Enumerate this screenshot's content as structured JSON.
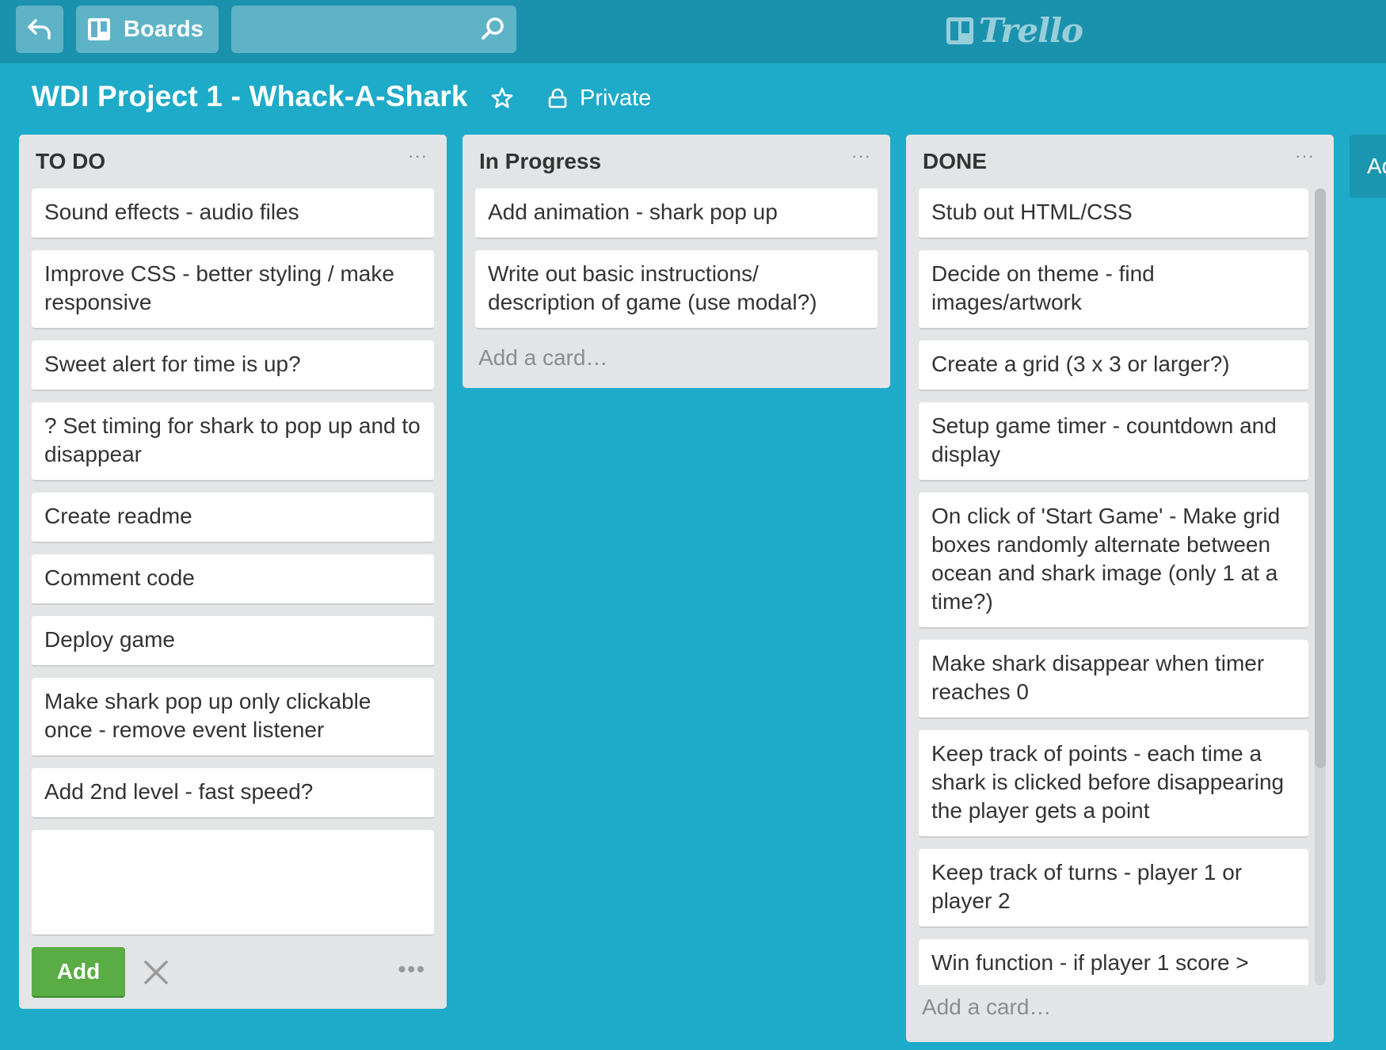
{
  "topbar": {
    "boards_label": "Boards",
    "search_value": "",
    "logo_text": "Trello"
  },
  "board": {
    "title": "WDI Project 1 - Whack-A-Shark",
    "visibility": "Private"
  },
  "lists": [
    {
      "title": "TO DO",
      "menu": "···",
      "cards": [
        "Sound effects - audio files",
        "Improve CSS - better styling / make responsive",
        "Sweet alert for time is up?",
        "? Set timing for shark to pop up and to disappear",
        "Create readme",
        "Comment code",
        "Deploy game",
        "Make shark pop up only clickable once - remove event listener",
        "Add 2nd level - fast speed?"
      ],
      "composer": {
        "value": "",
        "add_label": "Add",
        "menu": "•••"
      }
    },
    {
      "title": "In Progress",
      "menu": "···",
      "cards": [
        "Add animation - shark pop up",
        "Write out basic instructions/ description of game (use modal?)"
      ],
      "add_card": "Add a card…"
    },
    {
      "title": "DONE",
      "menu": "···",
      "cards": [
        "Stub out HTML/CSS",
        "Decide on theme - find images/artwork",
        "Create a grid (3 x 3 or larger?)",
        "Setup game timer - countdown and display",
        "On click of 'Start Game' - Make grid boxes randomly alternate between ocean and shark image (only 1 at a time?)",
        "Make shark disappear when timer reaches 0",
        "Keep track of points - each time a shark is clicked before disappearing the player gets a point",
        "Keep track of turns - player 1 or player 2",
        "Win function - if player 1 score >"
      ],
      "add_card": "Add a card…"
    }
  ],
  "add_list": "Add a list…",
  "colors": {
    "board_bg": "#1eabc9",
    "header_bg": "#1a92ae",
    "list_bg": "#e2e4e6",
    "add_button": "#5aac44"
  }
}
